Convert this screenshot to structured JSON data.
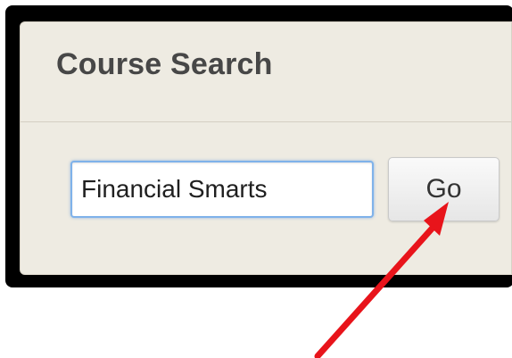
{
  "course_search": {
    "title": "Course Search",
    "search_value": "Financial Smarts",
    "go_button_label": "Go"
  },
  "annotation": {
    "arrow_color": "#e8141b",
    "frame_color": "#000000"
  },
  "colors": {
    "panel_background": "#eeebe2",
    "input_focus_border": "#7fb2ea",
    "title_text": "#474747"
  }
}
